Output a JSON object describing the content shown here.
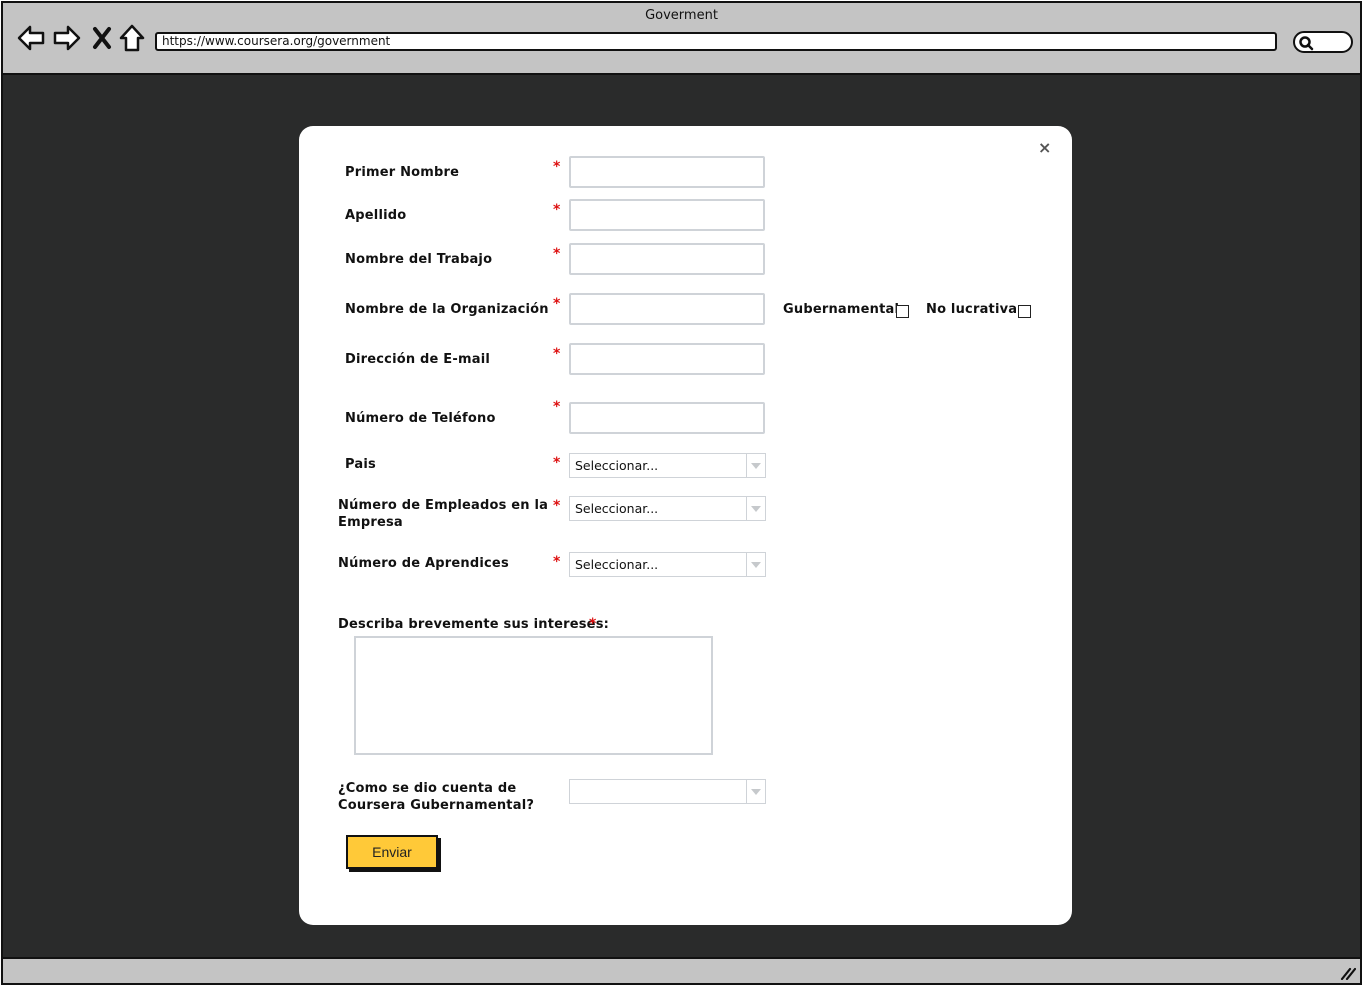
{
  "window": {
    "title": "Goverment",
    "url": "https://www.coursera.org/government"
  },
  "icons": {
    "back": "back-arrow-icon",
    "forward": "forward-arrow-icon",
    "stop": "close-x-icon",
    "home": "home-icon",
    "search": "search-icon",
    "close_modal": "close-icon",
    "resize": "resize-grip-icon"
  },
  "colors": {
    "toolbar": "#c4c4c4",
    "backdrop": "#2a2b2b",
    "required": "#dd1111",
    "submit_button": "#ffc938"
  },
  "form": {
    "close_label": "×",
    "required_mark": "*",
    "fields": {
      "first_name": "Primer Nombre",
      "last_name": "Apellido",
      "job_title": "Nombre del Trabajo",
      "organization": "Nombre de la Organización",
      "email": "Dirección de E-mail",
      "phone": "Número de Teléfono",
      "country": "Pais",
      "employees_line1": "Número de Empleados en la",
      "employees_line2": "Empresa",
      "learners": "Número de Aprendices",
      "interests": "Describa brevemente sus intereses:",
      "referral_line1": "¿Como se dio cuenta de",
      "referral_line2": "Coursera Gubernamental?"
    },
    "checkboxes": {
      "government": "Gubernamental",
      "nonprofit": "No lucrativa"
    },
    "select_placeholder": "Seleccionar...",
    "submit_label": "Enviar"
  }
}
